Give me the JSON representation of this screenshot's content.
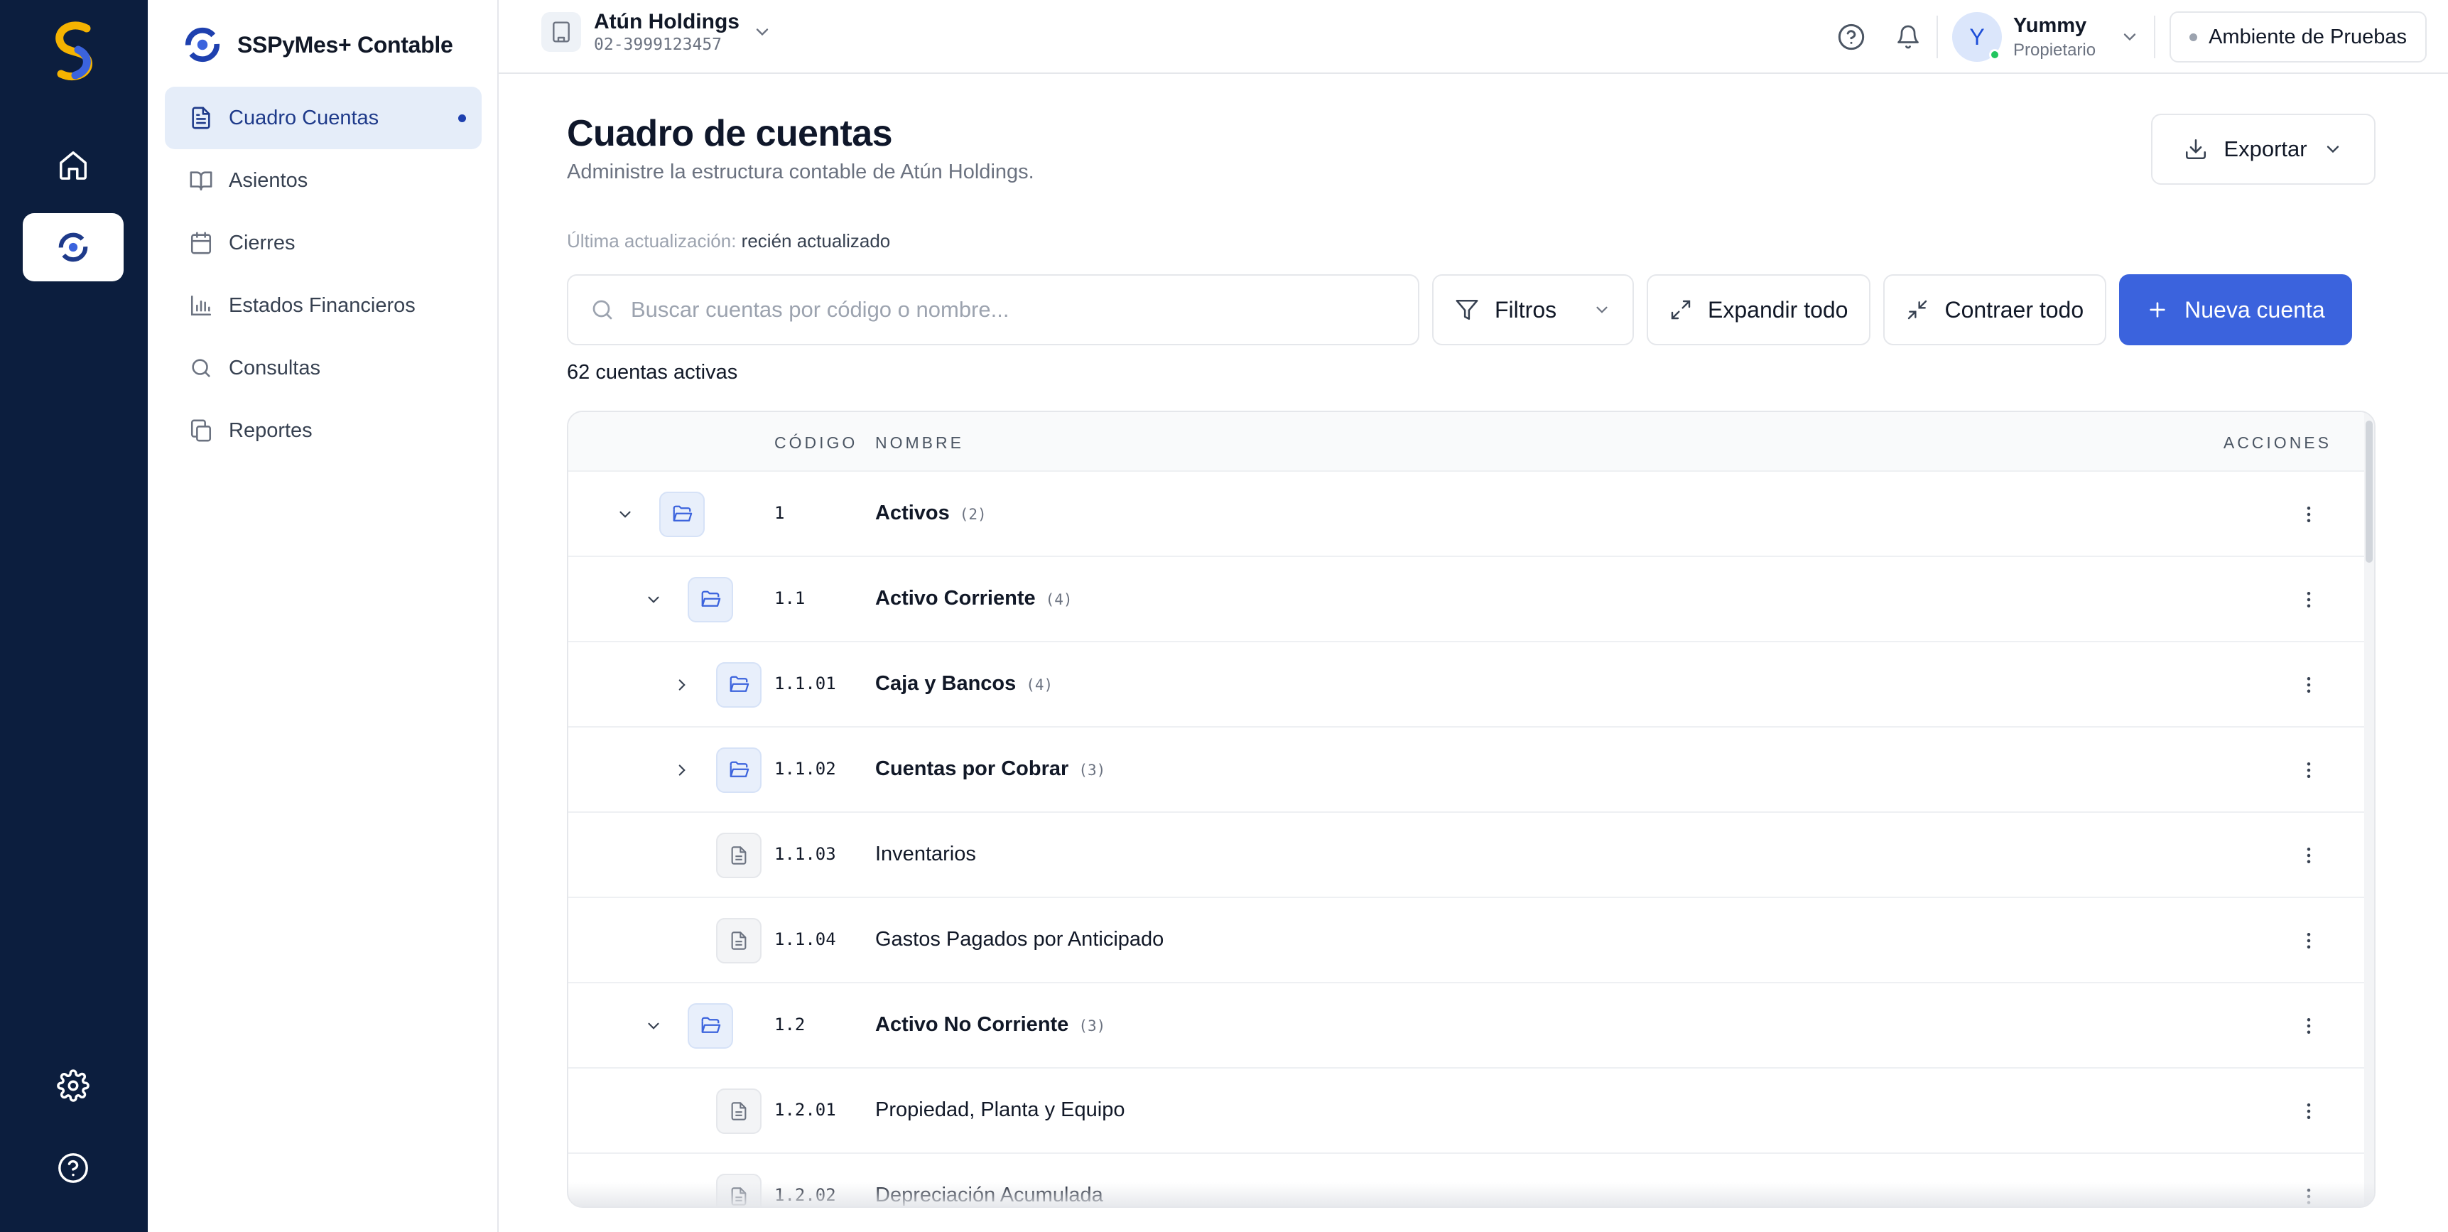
{
  "app": {
    "brand_name": "SSPyMes+ Contable"
  },
  "sidebar": {
    "items": [
      {
        "label": "Cuadro Cuentas",
        "icon": "file-text-icon",
        "active": true
      },
      {
        "label": "Asientos",
        "icon": "book-open-icon"
      },
      {
        "label": "Cierres",
        "icon": "calendar-icon"
      },
      {
        "label": "Estados Financieros",
        "icon": "bar-chart-icon"
      },
      {
        "label": "Consultas",
        "icon": "search-icon"
      },
      {
        "label": "Reportes",
        "icon": "copy-icon"
      }
    ]
  },
  "header": {
    "company_name": "Atún Holdings",
    "company_ruc": "02-3999123457",
    "user_initial": "Y",
    "user_name": "Yummy",
    "user_role": "Propietario",
    "environment": "Ambiente de Pruebas"
  },
  "page": {
    "title": "Cuadro de cuentas",
    "subtitle": "Administre la estructura contable de Atún Holdings.",
    "export_label": "Exportar",
    "updated_label": "Última actualización:",
    "updated_value": "recién actualizado",
    "search_placeholder": "Buscar cuentas por código o nombre...",
    "filters_label": "Filtros",
    "expand_all_label": "Expandir todo",
    "collapse_all_label": "Contraer todo",
    "new_account_label": "Nueva cuenta",
    "active_count": "62 cuentas activas"
  },
  "table": {
    "headers": {
      "code": "CÓDIGO",
      "name": "NOMBRE",
      "actions": "ACCIONES"
    },
    "rows": [
      {
        "code": "1",
        "name": "Activos",
        "count": "(2)",
        "level": 0,
        "type": "folder",
        "expanded": true
      },
      {
        "code": "1.1",
        "name": "Activo Corriente",
        "count": "(4)",
        "level": 1,
        "type": "folder",
        "expanded": true
      },
      {
        "code": "1.1.01",
        "name": "Caja y Bancos",
        "count": "(4)",
        "level": 2,
        "type": "folder",
        "expanded": false
      },
      {
        "code": "1.1.02",
        "name": "Cuentas por Cobrar",
        "count": "(3)",
        "level": 2,
        "type": "folder",
        "expanded": false
      },
      {
        "code": "1.1.03",
        "name": "Inventarios",
        "count": "",
        "level": 2,
        "type": "file"
      },
      {
        "code": "1.1.04",
        "name": "Gastos Pagados por Anticipado",
        "count": "",
        "level": 2,
        "type": "file"
      },
      {
        "code": "1.2",
        "name": "Activo No Corriente",
        "count": "(3)",
        "level": 1,
        "type": "folder",
        "expanded": true
      },
      {
        "code": "1.2.01",
        "name": "Propiedad, Planta y Equipo",
        "count": "",
        "level": 2,
        "type": "file"
      },
      {
        "code": "1.2.02",
        "name": "Depreciación Acumulada",
        "count": "",
        "level": 2,
        "type": "file"
      }
    ]
  },
  "colors": {
    "rail": "#0c1e3e",
    "primary": "#3b63dd",
    "active_nav_bg": "#e5edf9"
  }
}
